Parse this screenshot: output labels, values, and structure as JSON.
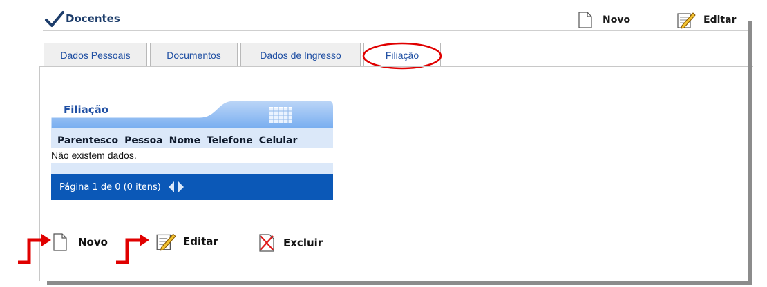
{
  "header": {
    "title": "Docentes",
    "buttons": {
      "novo": "Novo",
      "editar": "Editar"
    }
  },
  "tabs": [
    {
      "label": "Dados Pessoais"
    },
    {
      "label": "Documentos"
    },
    {
      "label": "Dados de Ingresso"
    },
    {
      "label": "Filiação",
      "active": true
    }
  ],
  "grid": {
    "title": "Filiação",
    "columns": [
      "Parentesco",
      "Pessoa",
      "Nome",
      "Telefone",
      "Celular"
    ],
    "empty_message": "Não existem dados.",
    "pager_text": "Página 1 de 0 (0 itens)"
  },
  "actions": {
    "novo": "Novo",
    "editar": "Editar",
    "excluir": "Excluir"
  },
  "colors": {
    "accent": "#1f4fa3",
    "pager_bg": "#0b58b7",
    "annotation_red": "#e00000"
  }
}
